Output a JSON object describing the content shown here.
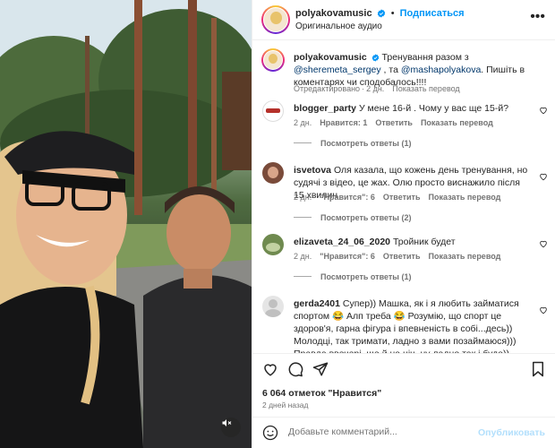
{
  "header": {
    "username": "polyakovamusic",
    "follow_label": "Подписаться",
    "separator": "•",
    "audio_label": "Оригинальное аудио",
    "more_label": "•••"
  },
  "caption": {
    "username": "polyakovamusic",
    "text_1": "Тренування разом з ",
    "mention_1": "@sheremeta_sergey",
    "text_2": " , та ",
    "mention_2": "@mashapolyakova",
    "text_3": ". Пишіть в коментарях чи сподобалось!!!!",
    "edited": "Отредактировано",
    "time": "2 дн.",
    "translate": "Показать перевод"
  },
  "comments": [
    {
      "username": "blogger_party",
      "text": "У мене 16-й . Чому у вас ще 15-й?",
      "time": "2 дн.",
      "likes": "Нравится: 1",
      "reply": "Ответить",
      "translate": "Показать перевод",
      "replies": "Посмотреть ответы (1)"
    },
    {
      "username": "isvetova",
      "text": "Оля казала, що кожень день тренування, но судячі з відео, це жах. Олю просто виснажило після 15 хвилин",
      "time": "2 дн.",
      "likes": "\"Нравится\": 6",
      "reply": "Ответить",
      "translate": "Показать перевод",
      "replies": "Посмотреть ответы (2)"
    },
    {
      "username": "elizaveta_24_06_2020",
      "text": "Тройник будет",
      "time": "2 дн.",
      "likes": "\"Нравится\": 6",
      "reply": "Ответить",
      "translate": "Показать перевод",
      "replies": "Посмотреть ответы (1)"
    },
    {
      "username": "gerda2401",
      "text": "Супер)) Машка, як і я любить займатися спортом 😂 Алп треба 😂 Розумію, що спорт це здоров'я, гарна фігура і впевненість в собі...десь)) Молодці, так тримати, ладно з вами позаймаюся))) Правда ввечері, ще й на ніч, ну ладно так і буде))"
    }
  ],
  "footer": {
    "likes": "6 064 отметок \"Нравится\"",
    "time_ago": "2 дней назад",
    "comment_placeholder": "Добавьте комментарий...",
    "publish_label": "Опубликовать"
  },
  "colors": {
    "link": "#0095f6",
    "mention": "#00376b",
    "muted": "#737373",
    "verified": "#0095f6"
  },
  "icons": [
    "verified-icon",
    "more-icon",
    "heart-icon",
    "comment-icon",
    "share-icon",
    "bookmark-icon",
    "emoji-icon",
    "mute-icon"
  ]
}
